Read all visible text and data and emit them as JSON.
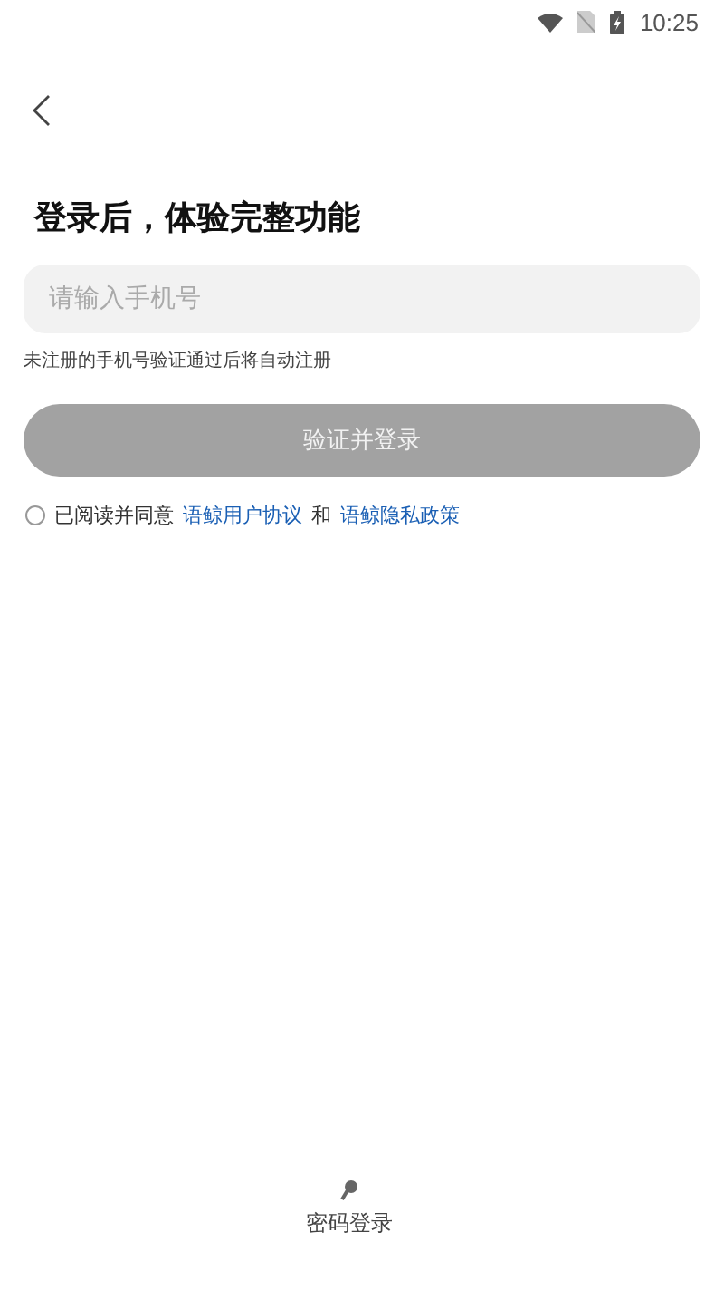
{
  "status_bar": {
    "time": "10:25"
  },
  "title": "登录后，体验完整功能",
  "phone_field": {
    "placeholder": "请输入手机号"
  },
  "hint": "未注册的手机号验证通过后将自动注册",
  "login_button": {
    "label": "验证并登录",
    "disabled": true
  },
  "agreement": {
    "checked": false,
    "text": "已阅读并同意",
    "links": [
      "语鲸用户协议",
      "语鲸隐私政策"
    ],
    "joiner": "和"
  },
  "alt_login": {
    "label": "密码登录"
  }
}
